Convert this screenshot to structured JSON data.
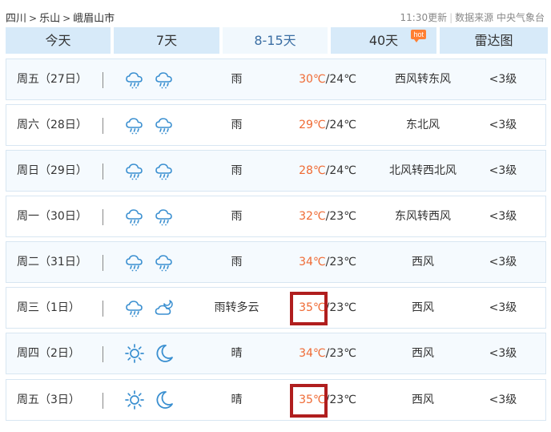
{
  "breadcrumb": {
    "province": "四川",
    "city": "乐山",
    "county": "峨眉山市",
    "separator": ">"
  },
  "source": {
    "update_time": "11:30更新",
    "divider": "|",
    "text": "数据来源 中央气象台"
  },
  "tabs": [
    {
      "label": "今天",
      "active": false
    },
    {
      "label": "7天",
      "active": false
    },
    {
      "label": "8-15天",
      "active": true
    },
    {
      "label": "40天",
      "active": false,
      "badge": "hot"
    },
    {
      "label": "雷达图",
      "active": false
    }
  ],
  "temp_unit": "℃",
  "temp_sep": "/",
  "colors": {
    "accent": "#3b6ea3",
    "tab_bg": "#d7eaf9",
    "high_temp": "#ef6a34",
    "hot_badge": "#ff7f33",
    "highlight_box": "#b01e1e"
  },
  "forecast": [
    {
      "date": "周五（27日）",
      "icon_day": "rain-cloud-icon",
      "icon_night": "rain-cloud-icon",
      "condition": "雨",
      "high": "30",
      "low": "24",
      "wind": "西风转东风",
      "level": "<3级",
      "highlight": false
    },
    {
      "date": "周六（28日）",
      "icon_day": "rain-cloud-icon",
      "icon_night": "rain-cloud-icon",
      "condition": "雨",
      "high": "29",
      "low": "24",
      "wind": "东北风",
      "level": "<3级",
      "highlight": false
    },
    {
      "date": "周日（29日）",
      "icon_day": "rain-cloud-icon",
      "icon_night": "rain-cloud-icon",
      "condition": "雨",
      "high": "28",
      "low": "24",
      "wind": "北风转西北风",
      "level": "<3级",
      "highlight": false
    },
    {
      "date": "周一（30日）",
      "icon_day": "rain-cloud-icon",
      "icon_night": "rain-cloud-icon",
      "condition": "雨",
      "high": "32",
      "low": "23",
      "wind": "东风转西风",
      "level": "<3级",
      "highlight": false
    },
    {
      "date": "周二（31日）",
      "icon_day": "rain-cloud-icon",
      "icon_night": "rain-cloud-icon",
      "condition": "雨",
      "high": "34",
      "low": "23",
      "wind": "西风",
      "level": "<3级",
      "highlight": false
    },
    {
      "date": "周三（1日）",
      "icon_day": "rain-cloud-icon",
      "icon_night": "moon-cloud-icon",
      "condition": "雨转多云",
      "high": "35",
      "low": "23",
      "wind": "西风",
      "level": "<3级",
      "highlight": true
    },
    {
      "date": "周四（2日）",
      "icon_day": "sun-icon",
      "icon_night": "moon-icon",
      "condition": "晴",
      "high": "34",
      "low": "23",
      "wind": "西风",
      "level": "<3级",
      "highlight": false
    },
    {
      "date": "周五（3日）",
      "icon_day": "sun-icon",
      "icon_night": "moon-icon",
      "condition": "晴",
      "high": "35",
      "low": "23",
      "wind": "西风",
      "level": "<3级",
      "highlight": true
    }
  ]
}
